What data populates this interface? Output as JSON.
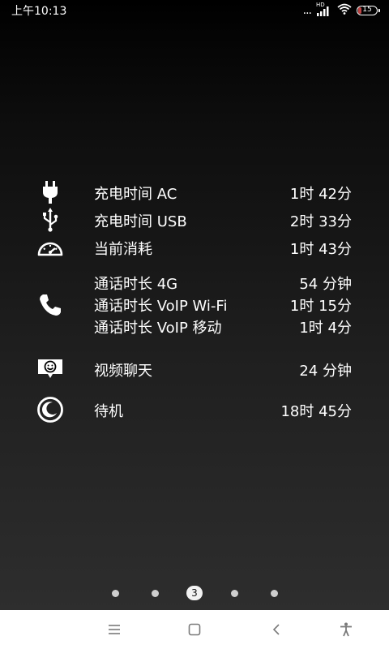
{
  "status_bar": {
    "time": "上午10:13",
    "signal_extra": "...",
    "network_badge": "HD",
    "battery_level": "15",
    "battery_fraction": 0.15,
    "icons": [
      "dots-icon",
      "hd-signal-icon",
      "wifi-icon",
      "battery-icon"
    ]
  },
  "stats": {
    "charge_ac": {
      "label": "充电时间 AC",
      "value": "1时 42分",
      "icon": "plug-icon"
    },
    "charge_usb": {
      "label": "充电时间 USB",
      "value": "2时 33分",
      "icon": "usb-icon"
    },
    "current_usage": {
      "label": "当前消耗",
      "value": "1时 43分",
      "icon": "speedometer-icon"
    },
    "talk": {
      "icon": "phone-icon",
      "lines": [
        {
          "label": "通话时长 4G",
          "value": "54 分钟"
        },
        {
          "label": "通话时长 VoIP Wi-Fi",
          "value": "1时 15分"
        },
        {
          "label": "通话时长 VoIP 移动",
          "value": "1时 4分"
        }
      ]
    },
    "video_chat": {
      "label": "视频聊天",
      "value": "24 分钟",
      "icon": "video-chat-icon"
    },
    "standby": {
      "label": "待机",
      "value": "18时 45分",
      "icon": "moon-icon"
    }
  },
  "pager": {
    "active_label": "3",
    "total_pages": 5,
    "active_index": 2
  },
  "nav_bar": {
    "buttons": [
      "menu-icon",
      "home-icon",
      "back-icon",
      "accessibility-icon"
    ]
  },
  "colors": {
    "background_top": "#000000",
    "background_bottom": "#303030",
    "text": "#ffffff",
    "nav_bar": "#ffffff",
    "nav_icon": "#7a7a7a",
    "battery_low": "#e05050"
  }
}
